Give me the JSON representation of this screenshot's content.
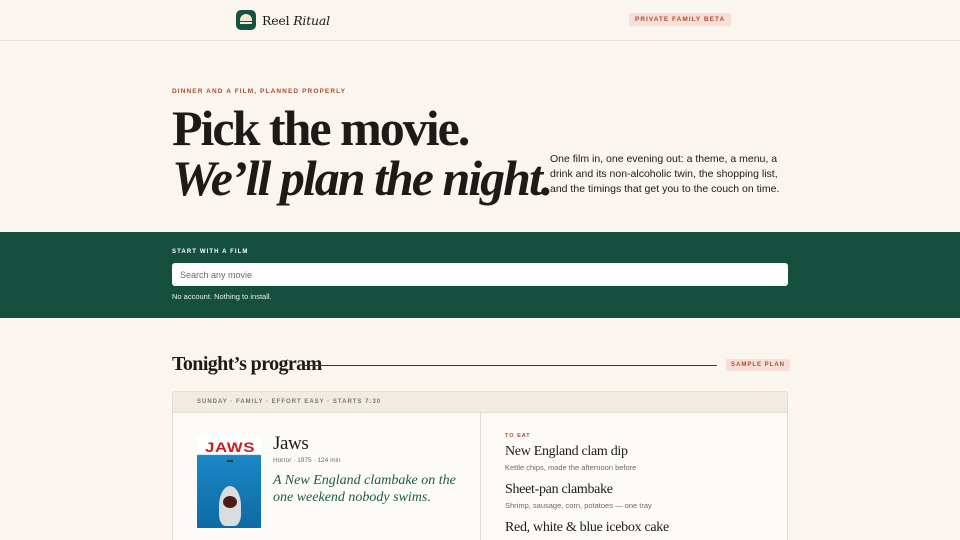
{
  "header": {
    "logo_word1": "Reel",
    "logo_word2": "Ritual",
    "badge": "PRIVATE FAMILY BETA"
  },
  "hero": {
    "eyebrow": "DINNER AND A FILM, PLANNED PROPERLY",
    "title_line1": "Pick the movie.",
    "title_line2": "We’ll plan the night.",
    "description": "One film in, one evening out: a theme, a menu, a drink and its non-alcoholic twin, the shopping list, and the timings that get you to the couch on time."
  },
  "search": {
    "label": "START WITH A FILM",
    "placeholder": "Search any movie",
    "note": "No account. Nothing to install."
  },
  "program": {
    "title": "Tonight’s program",
    "badge": "SAMPLE PLAN",
    "meta": "SUNDAY · FAMILY · EFFORT EASY · STARTS 7:30",
    "film": {
      "poster_text": "JAWS",
      "title": "Jaws",
      "meta": "Horror · 1975 · 124 min",
      "tagline": "A New England clambake on the one weekend nobody swims."
    },
    "eat_label": "TO EAT",
    "dishes": [
      {
        "name": "New England clam dip",
        "desc": "Kettle chips, made the afternoon before"
      },
      {
        "name": "Sheet-pan clambake",
        "desc": "Shrimp, sausage, corn, potatoes — one tray"
      },
      {
        "name": "Red, white & blue icebox cake",
        "desc": ""
      }
    ]
  },
  "colors": {
    "background": "#faf6ef",
    "brand_green": "#15503f",
    "accent_red": "#b04a2f",
    "badge_bg": "#f6dfd6"
  }
}
